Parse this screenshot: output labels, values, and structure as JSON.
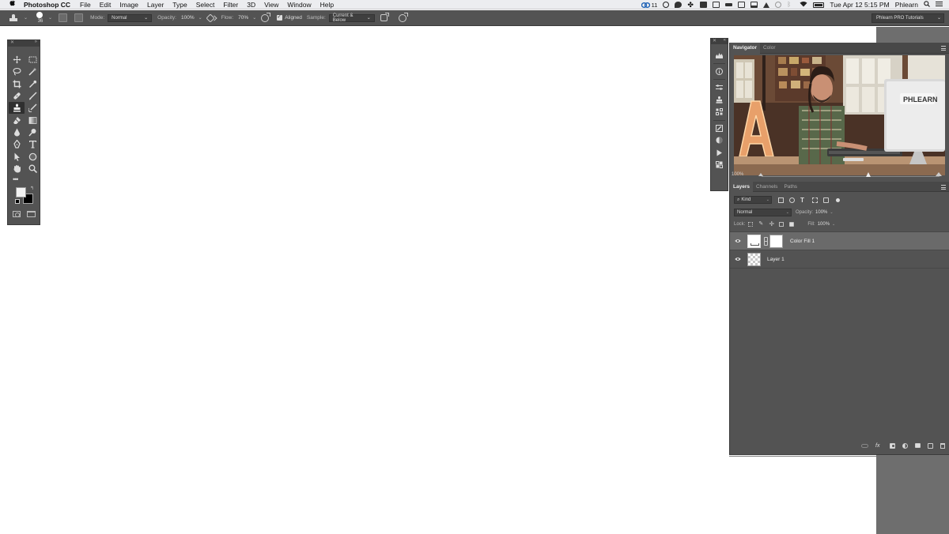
{
  "menubar": {
    "apple": "",
    "app_name": "Photoshop CC",
    "items": [
      "File",
      "Edit",
      "Image",
      "Layer",
      "Type",
      "Select",
      "Filter",
      "3D",
      "View",
      "Window",
      "Help"
    ],
    "cc_badge": "11",
    "datetime": "Tue Apr 12  5:15 PM",
    "user": "Phlearn"
  },
  "options": {
    "brush_size": "36",
    "mode_label": "Mode:",
    "mode_value": "Normal",
    "opacity_label": "Opacity:",
    "opacity_value": "100%",
    "flow_label": "Flow:",
    "flow_value": "70%",
    "aligned_label": "Aligned",
    "sample_label": "Sample:",
    "sample_value": "Current & Below",
    "workspace": "Phlearn PRO Tutorials"
  },
  "navigator": {
    "tabs": [
      "Navigator",
      "Color"
    ],
    "zoom": "100%",
    "zoom_fraction": 0.6
  },
  "layers": {
    "tabs": [
      "Layers",
      "Channels",
      "Paths"
    ],
    "filter_kind": "Kind",
    "blend_mode": "Normal",
    "opacity_label": "Opacity:",
    "opacity_value": "100%",
    "lock_label": "Lock:",
    "fill_label": "Fill:",
    "fill_value": "100%",
    "rows": [
      {
        "name": "Color Fill 1"
      },
      {
        "name": "Layer 1"
      }
    ]
  },
  "colors": {
    "panel_bg": "#535353",
    "canvas": "#ffffff",
    "foreground": "#f2f2f2",
    "background": "#000000"
  },
  "icons": {
    "tools": [
      "move-icon",
      "marquee-icon",
      "lasso-icon",
      "magic-wand-icon",
      "crop-icon",
      "eyedropper-icon",
      "healing-brush-icon",
      "brush-icon",
      "clone-stamp-icon",
      "history-brush-icon",
      "eraser-icon",
      "gradient-icon",
      "blur-icon",
      "dodge-icon",
      "pen-icon",
      "type-icon",
      "path-selection-icon",
      "ellipse-icon",
      "hand-icon",
      "zoom-icon"
    ]
  }
}
